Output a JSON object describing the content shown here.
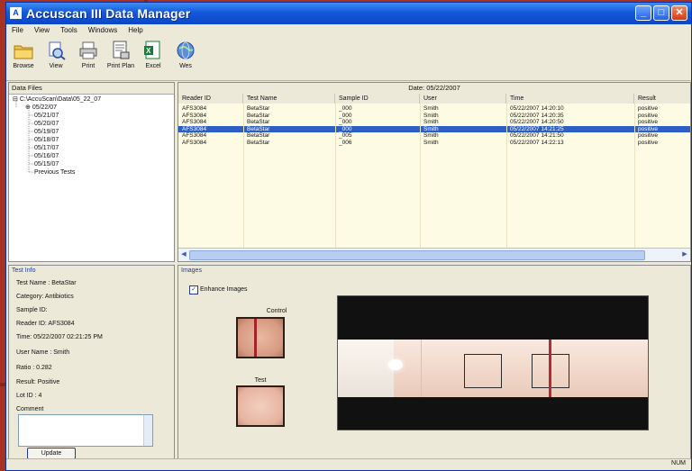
{
  "window": {
    "title": "Accuscan III Data Manager"
  },
  "menu": [
    "File",
    "View",
    "Tools",
    "Windows",
    "Help"
  ],
  "toolbar": [
    {
      "label": "Browse",
      "icon": "folder-icon"
    },
    {
      "label": "View",
      "icon": "view-icon"
    },
    {
      "label": "Print",
      "icon": "printer-icon"
    },
    {
      "label": "Print Plan",
      "icon": "print-plan-icon"
    },
    {
      "label": "Excel",
      "icon": "excel-icon"
    },
    {
      "label": "Wes",
      "icon": "globe-icon"
    }
  ],
  "data_files": {
    "title": "Data Files",
    "root": "C:\\AccuScan\\Data\\05_22_07",
    "nodes": [
      "05/22/07",
      "05/21/07",
      "05/20/07",
      "05/19/07",
      "05/18/07",
      "05/17/07",
      "05/16/07",
      "05/15/07",
      "Previous Tests"
    ]
  },
  "results": {
    "date_label": "Date: 05/22/2007",
    "columns": [
      "Reader ID",
      "Test Name",
      "Sample ID",
      "User",
      "Time",
      "Result"
    ],
    "rows": [
      [
        "AFS3084",
        "BetaStar",
        "_000",
        "Smith",
        "05/22/2007 14:20:10",
        "positive"
      ],
      [
        "AFS3084",
        "BetaStar",
        "_000",
        "Smith",
        "05/22/2007 14:20:35",
        "positive"
      ],
      [
        "AFS3084",
        "BetaStar",
        "_000",
        "Smith",
        "05/22/2007 14:20:50",
        "positive"
      ],
      [
        "AFS3084",
        "BetaStar",
        "_000",
        "Smith",
        "05/22/2007 14:21:25",
        "positive"
      ],
      [
        "AFS3084",
        "BetaStar",
        "_005",
        "Smith",
        "05/22/2007 14:21:50",
        "positive"
      ],
      [
        "AFS3084",
        "BetaStar",
        "_006",
        "Smith",
        "05/22/2007 14:22:13",
        "positive"
      ]
    ],
    "selected_row": 3
  },
  "test_info": {
    "title": "Test Info",
    "lines": [
      "Test Name : BetaStar",
      "Category: Antibiotics",
      "Sample ID:",
      "Reader ID: AFS3084",
      "Time: 05/22/2007 02:21:25 PM",
      "User Name : Smith",
      "Ratio : 0.282",
      "Result: Positive",
      "Lot ID : 4",
      "Comment"
    ],
    "update_label": "Update"
  },
  "images": {
    "title": "Images",
    "enhance_label": "Enhance Images",
    "enhance_checked": true,
    "control_label": "Control",
    "test_label": "Test"
  },
  "status": {
    "num": "NUM"
  },
  "colors": {
    "title_bar": "#0a47c8",
    "selection": "#2c5fc4",
    "grid_background": "#fdfbe3",
    "frame": "#a73222"
  }
}
